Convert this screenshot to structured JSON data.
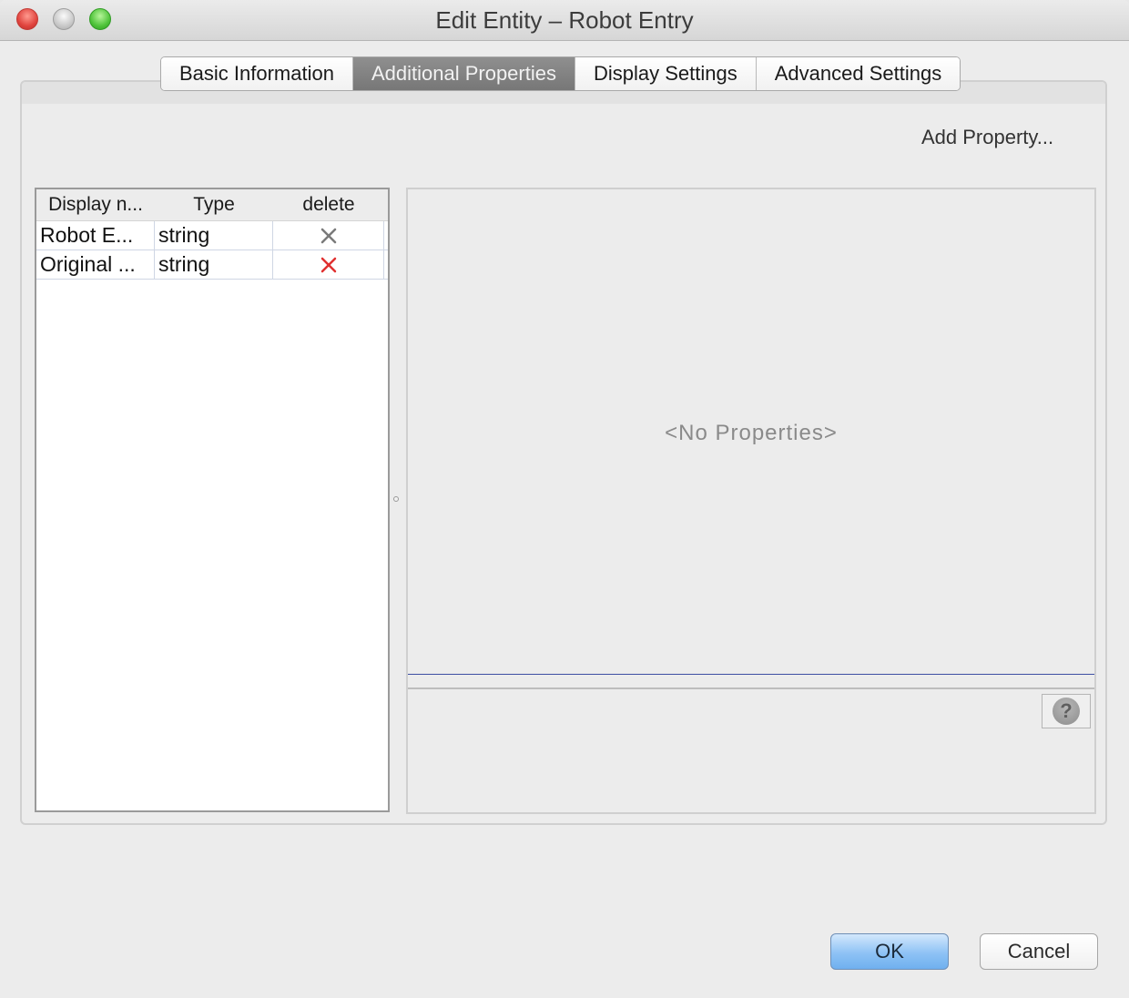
{
  "window": {
    "title": "Edit Entity – Robot Entry"
  },
  "tabs": [
    {
      "label": "Basic Information",
      "active": false
    },
    {
      "label": "Additional Properties",
      "active": true
    },
    {
      "label": "Display Settings",
      "active": false
    },
    {
      "label": "Advanced Settings",
      "active": false
    }
  ],
  "toolbar": {
    "add_property_label": "Add Property..."
  },
  "table": {
    "columns": [
      "Display n...",
      "Type",
      "delete"
    ],
    "rows": [
      {
        "display_name": "Robot E...",
        "type": "string",
        "delete_icon": "x-gray-icon"
      },
      {
        "display_name": "Original ...",
        "type": "string",
        "delete_icon": "x-red-icon"
      }
    ]
  },
  "properties_panel": {
    "empty_text": "<No Properties>"
  },
  "buttons": {
    "ok_label": "OK",
    "cancel_label": "Cancel"
  },
  "colors": {
    "active_tab": "#808080",
    "ok_button": "#8ec2f5",
    "delete_red": "#e03030",
    "delete_gray": "#7a7a7a"
  }
}
